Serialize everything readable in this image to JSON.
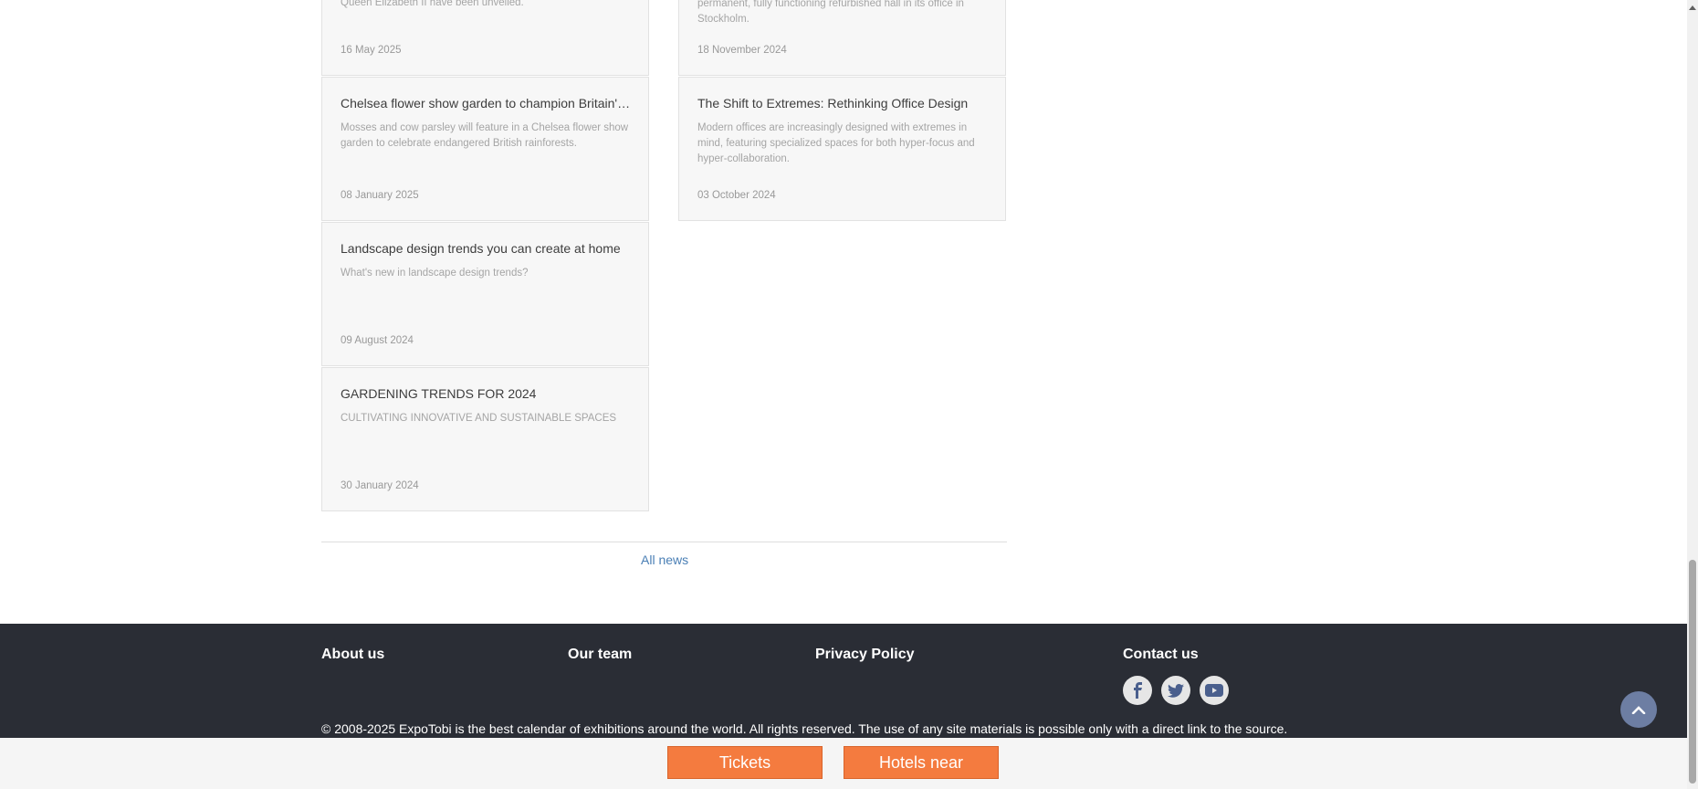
{
  "news": {
    "left_column": [
      {
        "title": "",
        "desc": "Queen Elizabeth II have been unveiled.",
        "date": "16 May 2025"
      },
      {
        "title": "Chelsea flower show garden to champion Britain's rainforests",
        "desc": "Mosses and cow parsley will feature in a Chelsea flower show garden to celebrate endangered British rainforests.",
        "date": "08 January 2025"
      },
      {
        "title": "Landscape design trends you can create at home",
        "desc": "What's new in landscape design trends?",
        "date": "09 August 2024"
      },
      {
        "title": "GARDENING TRENDS FOR 2024",
        "desc": "CULTIVATING INNOVATIVE AND SUSTAINABLE SPACES",
        "date": "30 January 2024"
      }
    ],
    "right_column": [
      {
        "title": "",
        "desc": "permanent, fully functioning refurbished hall in its office in Stockholm.",
        "date": "18 November 2024"
      },
      {
        "title": "The Shift to Extremes: Rethinking Office Design",
        "desc": "Modern offices are increasingly designed with extremes in mind, featuring specialized spaces for both hyper-focus and hyper-collaboration.",
        "date": "03 October 2024"
      }
    ],
    "all_news_label": "All news"
  },
  "footer": {
    "links": [
      "About us",
      "Our team",
      "Privacy Policy",
      "Contact us"
    ],
    "social_icons": [
      "facebook-icon",
      "twitter-icon",
      "youtube-icon"
    ],
    "copyright": "© 2008-2025 ExpoTobi is the best calendar of exhibitions around the world. All rights reserved. The use of any site materials is possible only with a direct link to the source."
  },
  "bottom_bar": {
    "tickets_label": "Tickets",
    "hotels_label": "Hotels near"
  },
  "colors": {
    "footer_bg": "#2a2d35",
    "accent_orange": "#f47b3f",
    "link_blue": "#4a7fb5",
    "card_bg": "#f7f7f7"
  }
}
